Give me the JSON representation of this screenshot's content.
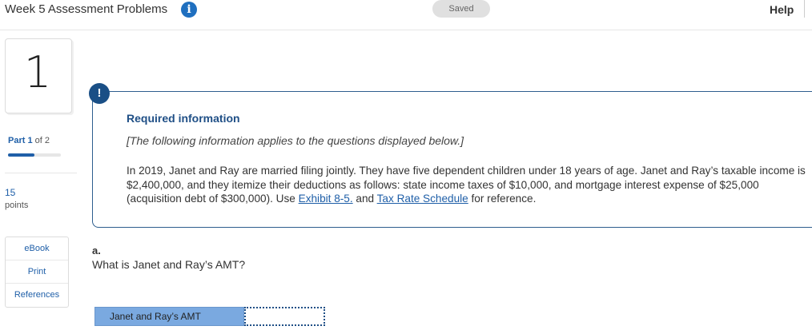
{
  "header": {
    "title": "Week 5 Assessment Problems",
    "info_icon": "i",
    "saved_label": "Saved",
    "help_label": "Help"
  },
  "sidebar": {
    "question_number": "1",
    "part_label": "Part",
    "part_current": "1",
    "part_of": "of 2",
    "part_progress": 0.5,
    "points_value": "15",
    "points_label": "points",
    "resources": [
      {
        "label": "eBook"
      },
      {
        "label": "Print"
      },
      {
        "label": "References"
      }
    ]
  },
  "required_info": {
    "alert_icon": "!",
    "title": "Required information",
    "subtitle": "[The following information applies to the questions displayed below.]",
    "body_pre": "In 2019, Janet and Ray are married filing jointly. They have five dependent children under 18 years of age. Janet and Ray’s taxable income is $2,400,000, and they itemize their deductions as follows: state income taxes of $10,000, and mortgage interest expense of $25,000 (acquisition debt of $300,000). Use ",
    "link1": "Exhibit 8-5.",
    "body_mid": " and ",
    "link2": "Tax Rate Schedule",
    "body_post": " for reference."
  },
  "question": {
    "letter": "a.",
    "text": "What is Janet and Ray’s AMT?",
    "answer_label": "Janet and Ray’s AMT",
    "answer_value": ""
  },
  "colors": {
    "accent": "#1f5fa8",
    "alert_bg": "#1a4f86",
    "answer_label_bg": "#7aa9e0"
  }
}
